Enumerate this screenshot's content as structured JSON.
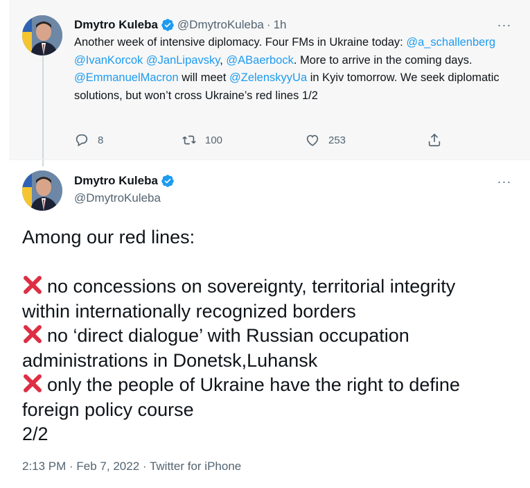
{
  "tweet1": {
    "name": "Dmytro Kuleba",
    "handle": "@DmytroKuleba",
    "separator": "·",
    "time": "1h",
    "text": {
      "p1": "Another week of intensive diplomacy. Four FMs in Ukraine today: ",
      "m1": "@a_schallenberg",
      "p2": " ",
      "m2": "@IvanKorcok",
      "p3": " ",
      "m3": "@JanLipavsky",
      "p4": ", ",
      "m4": "@ABaerbock",
      "p5": ". More to arrive in the coming days. ",
      "m5": "@EmmanuelMacron",
      "p6": " will meet ",
      "m6": "@ZelenskyyUa",
      "p7": " in Kyiv tomorrow. We seek diplomatic solutions, but won’t cross Ukraine’s red lines 1/2"
    },
    "replies": "8",
    "retweets": "100",
    "likes": "253",
    "more": "···"
  },
  "tweet2": {
    "name": "Dmytro Kuleba",
    "handle": "@DmytroKuleba",
    "more": "···",
    "lines": {
      "intro": "Among our red lines:",
      "l1a": "no concessions on sovereignty, territorial integrity",
      "l1b": "within internationally recognized borders",
      "l2a": "no ‘direct dialogue’ with Russian occupation",
      "l2b": "administrations in Donetsk,Luhansk",
      "l3a": "only the people of Ukraine have the right to define",
      "l3b": "foreign policy course",
      "end": "2/2"
    },
    "timestamp": "2:13 PM · Feb 7, 2022 · Twitter for iPhone"
  },
  "colors": {
    "link": "#1d9bf0",
    "muted": "#536471",
    "verified": "#1d9bf0",
    "xmark": "#dd2e44"
  },
  "icons": [
    "verified-badge-icon",
    "more-icon",
    "reply-icon",
    "retweet-icon",
    "like-icon",
    "share-icon",
    "cross-mark-icon"
  ]
}
